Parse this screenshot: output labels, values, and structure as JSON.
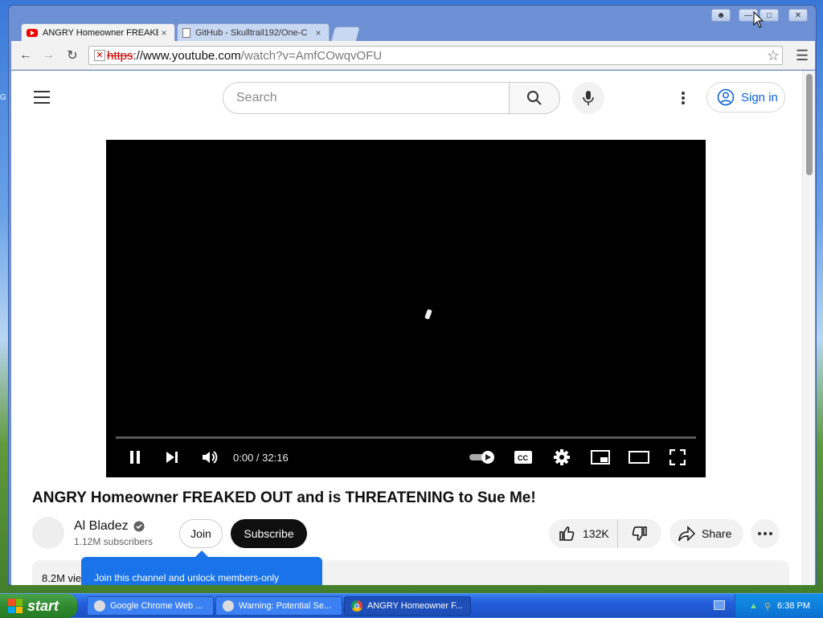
{
  "browser": {
    "tabs": [
      {
        "title": "ANGRY Homeowner FREAKED",
        "close": "×"
      },
      {
        "title": "GitHub - Skulltrail192/One-C",
        "close": "×"
      }
    ],
    "url": {
      "scheme": "https",
      "host": "://www.youtube.com",
      "path": "/watch?v=AmfCOwqvOFU"
    },
    "window_buttons": [
      "minimize",
      "maximize",
      "close"
    ]
  },
  "youtube": {
    "search_placeholder": "Search",
    "sign_in": "Sign in",
    "player": {
      "time": "0:00 / 32:16",
      "progress": 0
    },
    "video_title": "ANGRY Homeowner FREAKED OUT and is THREATENING to Sue Me!",
    "channel": {
      "name": "Al Bladez",
      "subscribers": "1.12M subscribers"
    },
    "join_label": "Join",
    "subscribe_label": "Subscribe",
    "likes": "132K",
    "share_label": "Share",
    "description_preview": "8.2M vie",
    "tooltip": "Join this channel and unlock members-only"
  },
  "taskbar": {
    "start_label": "start",
    "items": [
      {
        "label": "Google Chrome Web ..."
      },
      {
        "label": "Warning: Potential Se..."
      },
      {
        "label": "ANGRY Homeowner F..."
      }
    ],
    "clock": "6:38 PM"
  },
  "colors": {
    "accent": "#065fd4",
    "taskbar": "#245edb",
    "tooltip": "#1a73e8"
  }
}
